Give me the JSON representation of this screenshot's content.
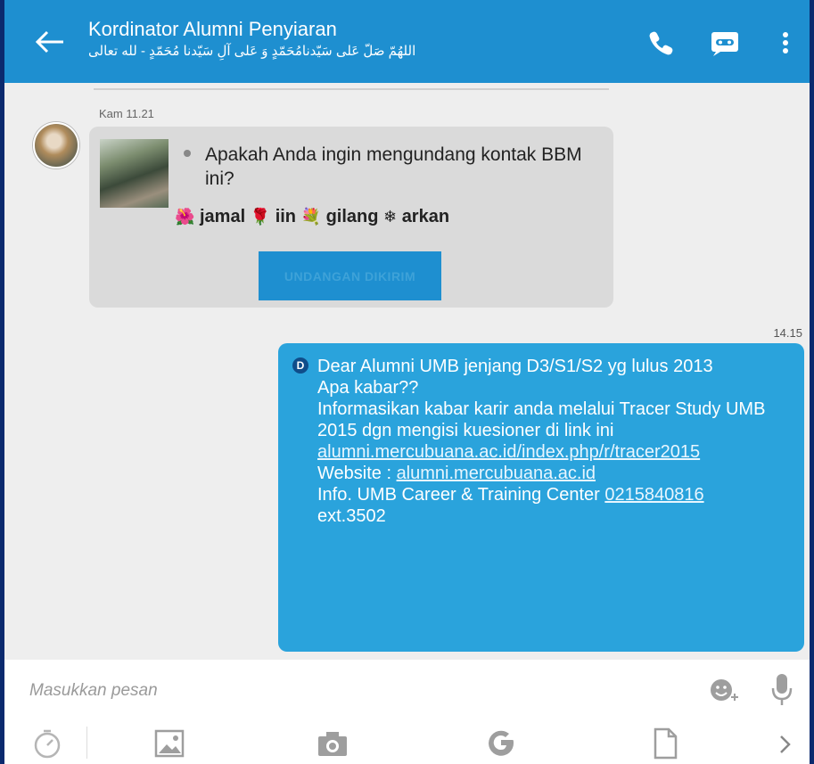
{
  "header": {
    "title": "Kordinator Alumni Penyiaran",
    "subtitle": "اللهُمّ صَلّ عَلى سَيّدنامُحَمّدٍ وَ عَلى آلِ سَيّدنا مُحَمّدٍ - لله تعالى"
  },
  "incoming": {
    "time": "Kam 11.21",
    "invite_text": "Apakah Anda ingin mengundang kontak BBM ini?",
    "names": [
      "jamal",
      "iin",
      "gilang",
      "arkan"
    ],
    "button_label": "UNDANGAN DIKIRIM"
  },
  "outgoing": {
    "time": "14.15",
    "badge": "D",
    "line1": "Dear Alumni UMB jenjang D3/S1/S2 yg lulus 2013",
    "line2": "Apa kabar??",
    "line3": "Informasikan kabar karir anda melalui Tracer Study UMB 2015 dgn mengisi kuesioner di link ini",
    "link1": "alumni.mercubuana.ac.id/index.php/r/tracer2015",
    "website_label": "Website : ",
    "website_link": "alumni.mercubuana.ac.id",
    "info_label": "Info. UMB Career & Training Center ",
    "phone": "0215840816",
    "ext": "ext.3502"
  },
  "composer": {
    "placeholder": "Masukkan pesan"
  },
  "colors": {
    "accent": "#1e8fd0",
    "outgoing_bubble": "#2aa3dc",
    "incoming_bubble": "#dadada"
  },
  "icons": [
    "back-arrow-icon",
    "phone-icon",
    "bbm-video-icon",
    "more-vert-icon",
    "emoji-icon",
    "mic-icon",
    "timer-icon",
    "image-icon",
    "camera-icon",
    "google-icon",
    "file-icon",
    "chevron-right-icon"
  ]
}
